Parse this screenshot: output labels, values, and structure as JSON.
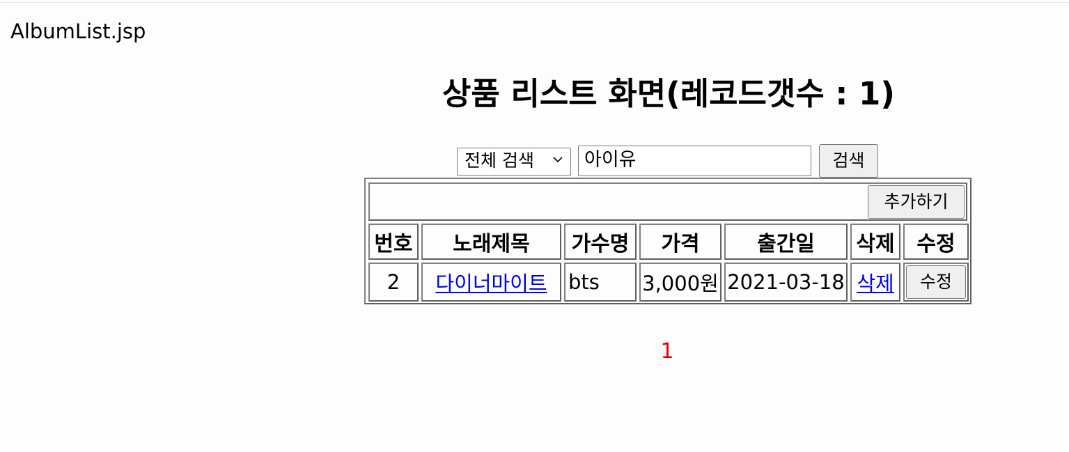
{
  "file_label": "AlbumList.jsp",
  "page_title": "상품 리스트 화면(레코드갯수 : 1)",
  "search": {
    "select_value": "전체 검색",
    "input_value": "아이유",
    "button_label": "검색"
  },
  "table": {
    "add_button_label": "추가하기",
    "headers": [
      "번호",
      "노래제목",
      "가수명",
      "가격",
      "출간일",
      "삭제",
      "수정"
    ],
    "rows": [
      {
        "no": "2",
        "title": "다이너마이트",
        "artist": "bts",
        "price": "3,000원",
        "date": "2021-03-18",
        "delete_label": "삭제",
        "edit_label": "수정"
      }
    ]
  },
  "pagination": {
    "current": "1",
    "color": "#e30000"
  },
  "colors": {
    "link": "#0000ee",
    "button_bg": "#efefef",
    "table_border": "#5f5f5f"
  }
}
